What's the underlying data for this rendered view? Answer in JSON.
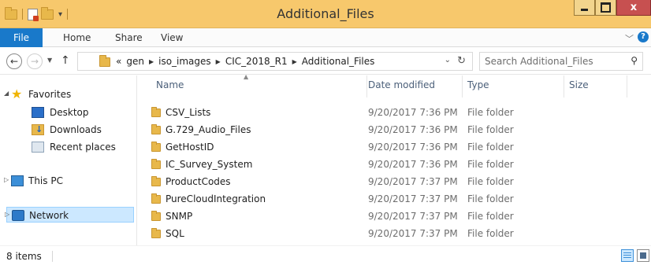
{
  "window": {
    "title": "Additional_Files",
    "close_glyph": "x"
  },
  "ribbon": {
    "tabs": [
      "File",
      "Home",
      "Share",
      "View"
    ],
    "help_glyph": "?"
  },
  "address": {
    "overflow_glyph": "«",
    "crumbs": [
      "gen",
      "iso_images",
      "CIC_2018_R1",
      "Additional_Files"
    ]
  },
  "search": {
    "placeholder": "Search Additional_Files"
  },
  "nav_pane": {
    "favorites": "Favorites",
    "desktop": "Desktop",
    "downloads": "Downloads",
    "recent_places": "Recent places",
    "this_pc": "This PC",
    "network": "Network"
  },
  "columns": {
    "name": "Name",
    "date_modified": "Date modified",
    "type": "Type",
    "size": "Size"
  },
  "files": [
    {
      "name": "CSV_Lists",
      "date": "9/20/2017 7:36 PM",
      "type": "File folder"
    },
    {
      "name": "G.729_Audio_Files",
      "date": "9/20/2017 7:36 PM",
      "type": "File folder"
    },
    {
      "name": "GetHostID",
      "date": "9/20/2017 7:36 PM",
      "type": "File folder"
    },
    {
      "name": "IC_Survey_System",
      "date": "9/20/2017 7:36 PM",
      "type": "File folder"
    },
    {
      "name": "ProductCodes",
      "date": "9/20/2017 7:37 PM",
      "type": "File folder"
    },
    {
      "name": "PureCloudIntegration",
      "date": "9/20/2017 7:37 PM",
      "type": "File folder"
    },
    {
      "name": "SNMP",
      "date": "9/20/2017 7:37 PM",
      "type": "File folder"
    },
    {
      "name": "SQL",
      "date": "9/20/2017 7:37 PM",
      "type": "File folder"
    }
  ],
  "status": {
    "item_count": "8 items"
  },
  "icons": {
    "folder": "folder-icon",
    "back": "back-arrow-icon",
    "forward": "forward-arrow-icon",
    "up": "up-arrow-icon",
    "refresh": "refresh-icon",
    "search": "search-icon",
    "star": "star-icon",
    "desktop": "desktop-icon",
    "downloads": "downloads-icon",
    "recent": "recent-places-icon",
    "pc": "computer-icon",
    "network": "network-icon"
  },
  "colors": {
    "titlebar": "#f7c86c",
    "file_tab": "#1979ca",
    "close_button": "#c75050",
    "selection": "#cce8ff"
  }
}
